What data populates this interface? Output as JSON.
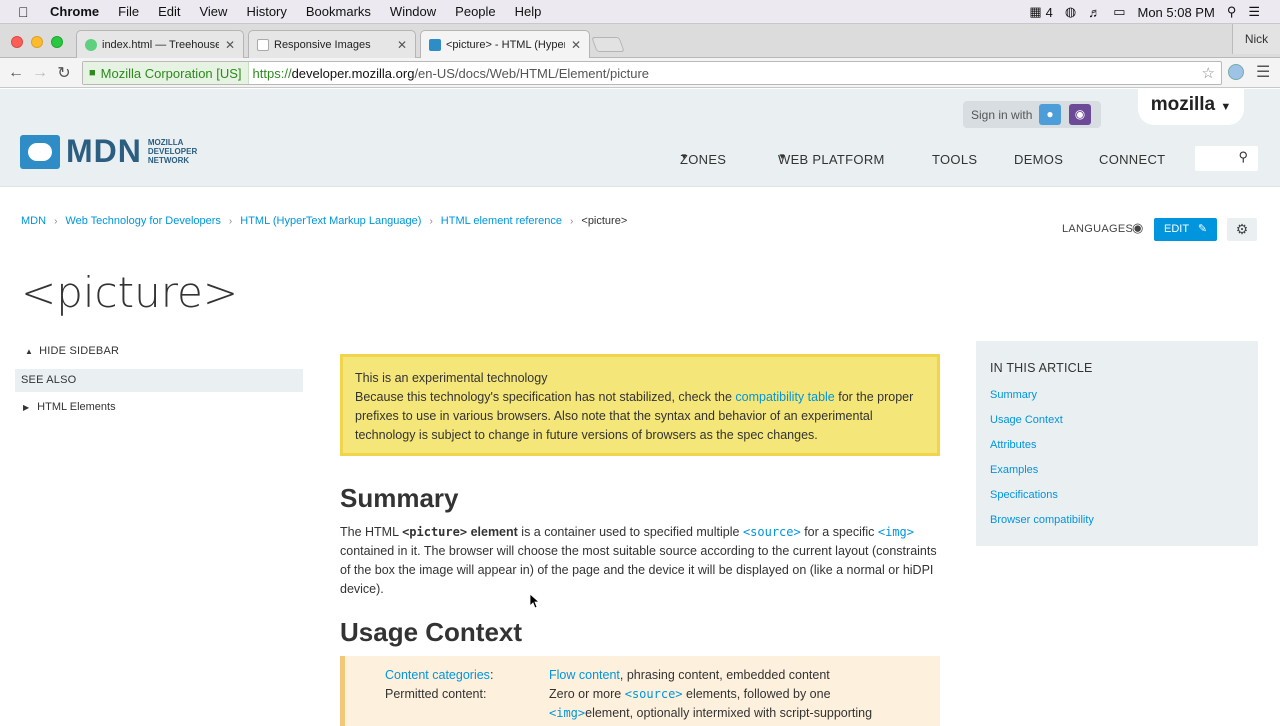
{
  "menubar": {
    "app": "Chrome",
    "items": [
      "File",
      "Edit",
      "View",
      "History",
      "Bookmarks",
      "Window",
      "People",
      "Help"
    ],
    "status_count": "4",
    "clock": "Mon 5:08 PM"
  },
  "browser": {
    "tabs": [
      {
        "label": "index.html — Treehouse W",
        "active": false
      },
      {
        "label": "Responsive Images",
        "active": false
      },
      {
        "label": "<picture> - HTML (HyperTe",
        "active": true
      }
    ],
    "profile": "Nick",
    "ev_label": "Mozilla Corporation [US]",
    "url_scheme": "https://",
    "url_host": "developer.mozilla.org",
    "url_path": "/en-US/docs/Web/HTML/Element/picture"
  },
  "header": {
    "logo_word": "MDN",
    "logo_sub": [
      "MOZILLA",
      "DEVELOPER",
      "NETWORK"
    ],
    "sign_in": "Sign in with",
    "mozilla": "mozilla",
    "nav": [
      "ZONES",
      "WEB PLATFORM",
      "TOOLS",
      "DEMOS",
      "CONNECT"
    ]
  },
  "breadcrumb": [
    "MDN",
    "Web Technology for Developers",
    "HTML (HyperText Markup Language)",
    "HTML element reference",
    "<picture>"
  ],
  "page": {
    "languages": "LANGUAGES",
    "edit": "EDIT",
    "title": "<picture>"
  },
  "sidebar": {
    "hide": "HIDE SIDEBAR",
    "see_also": "SEE ALSO",
    "item": "HTML Elements"
  },
  "notice": {
    "heading": "This is an experimental technology",
    "body_before": "Because this technology's specification has not stabilized, check the ",
    "link": "compatibility table",
    "body_after": " for the proper prefixes to use in various browsers. Also note that the syntax and behavior of an experimental technology is subject to change in future versions of browsers as the spec changes."
  },
  "summary": {
    "heading": "Summary",
    "t1": "The HTML ",
    "c1": "<picture>",
    "t2": " element",
    "t3": " is a container used to specified multiple ",
    "c2": "<source>",
    "t4": " for a specific ",
    "c3": "<img>",
    "t5": " contained in it. The browser will choose the most suitable source according to the current layout (constraints of the box the image will appear in) of the page and the device it will be displayed on (like a normal or hiDPI device)."
  },
  "usage": {
    "heading": "Usage Context",
    "k1": "Content categories",
    "k1_colon": ":",
    "v1_link": "Flow content",
    "v1_rest": ", phrasing content, embedded content",
    "k2": "Permitted content:",
    "v2_before": "Zero or more ",
    "v2_code": "<source>",
    "v2_after": " elements, followed by one",
    "v3_code": "<img>",
    "v3_after": "element, optionally intermixed with script-supporting"
  },
  "toc": {
    "heading": "IN THIS ARTICLE",
    "items": [
      "Summary",
      "Usage Context",
      "Attributes",
      "Examples",
      "Specifications",
      "Browser compatibility"
    ]
  },
  "colors": {
    "mdn_blue": "#0095dd",
    "notice_bg": "#f5e67a",
    "header_bg": "#eaeff2"
  }
}
